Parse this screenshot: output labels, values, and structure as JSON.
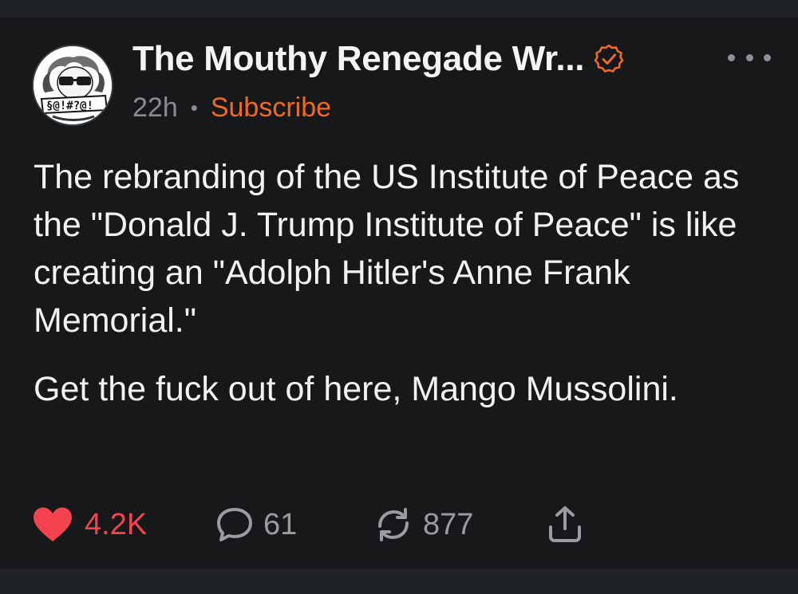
{
  "post": {
    "author_name": "The Mouthy Renegade Wr...",
    "time": "22h",
    "separator": "•",
    "subscribe_label": "Subscribe",
    "paragraphs": [
      "The rebranding of the US Institute of Peace as the \"Donald J. Trump Institute of Peace\" is like creating an \"Adolph Hitler's Anne Frank Memorial.\"",
      "Get the fuck out of here, Mango Mussolini."
    ]
  },
  "actions": {
    "likes": "4.2K",
    "replies": "61",
    "reposts": "877"
  },
  "colors": {
    "background": "#161819",
    "accent_orange": "#f06a22",
    "like_red": "#f4434f",
    "muted": "#9a9da0"
  },
  "icons": {
    "verified": "verified-badge-icon",
    "more": "more-options-icon",
    "like": "heart-icon",
    "reply": "comment-bubble-icon",
    "repost": "repost-arrows-icon",
    "share": "share-upload-icon"
  }
}
